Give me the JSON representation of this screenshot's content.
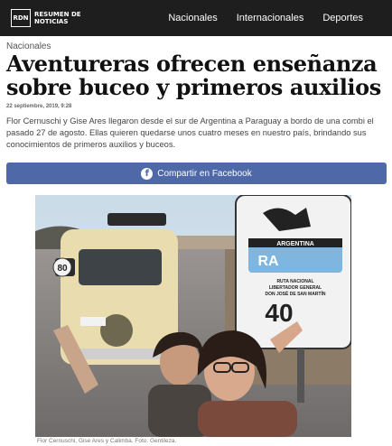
{
  "nav": {
    "logo": {
      "mark": "RDN",
      "line1": "RESUMEN DE",
      "line2": "NOTICIAS"
    },
    "links": [
      "Nacionales",
      "Internacionales",
      "Deportes"
    ]
  },
  "article": {
    "section": "Nacionales",
    "headline": "Aventureras ofrecen enseñanza sobre buceo y primeros auxilios",
    "date": "22 septiembre, 2019, 9:28",
    "lead": "Flor Cernuschi y Gise Ares llegaron desde el sur de Argentina a Paraguay a bordo de una combi el pasado 27 de agosto. Ellas quieren quedarse unos cuatro meses en nuestro país, brindando sus conocimientos de primeros auxilios y buceos.",
    "share_label": "Compartir en Facebook",
    "share_icon": "facebook-icon",
    "photo": {
      "van_plate_number": "80",
      "sign_country": "ARGENTINA",
      "sign_code": "RA",
      "sign_line1": "RUTA NACIONAL",
      "sign_line2": "LIBERTADOR GENERAL",
      "sign_line3": "DON JOSÉ DE SAN MARTÍN",
      "sign_number": "40"
    },
    "caption": "Flor Cernuschi, Gise Ares y Calimba. Foto: Gentileza."
  },
  "colors": {
    "navbar": "#1e1e1e",
    "share_button": "#4e68a8"
  }
}
